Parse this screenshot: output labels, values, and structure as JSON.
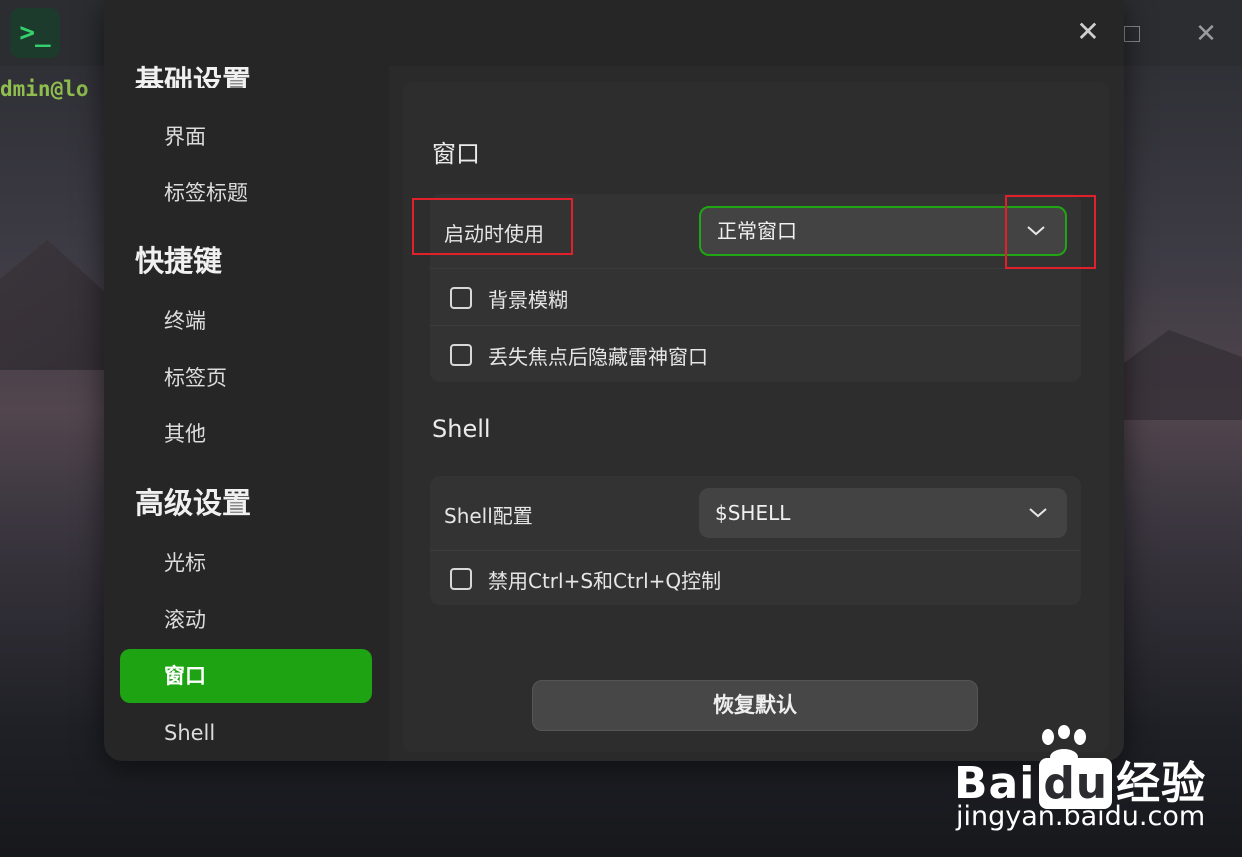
{
  "background": {
    "app_icon": "terminal-prompt-icon",
    "app_icon_glyph": ">_",
    "prompt_text": "dmin@lo",
    "max_icon": "maximize-icon",
    "close_icon": "close-icon"
  },
  "dialog": {
    "close_glyph": "✕",
    "sidebar": {
      "group_basic_partial": "基础设置",
      "items_basic": [
        "界面",
        "标签标题"
      ],
      "group_shortcuts": "快捷键",
      "items_shortcuts": [
        "终端",
        "标签页",
        "其他"
      ],
      "group_advanced": "高级设置",
      "items_advanced": [
        "光标",
        "滚动",
        "窗口",
        "Shell"
      ],
      "active_item": "窗口"
    },
    "window_section": {
      "title": "窗口",
      "startup_label": "启动时使用",
      "startup_value": "正常窗口",
      "blur_label": "背景模糊",
      "hide_label": "丢失焦点后隐藏雷神窗口"
    },
    "shell_section": {
      "title": "Shell",
      "config_label": "Shell配置",
      "config_value": "$SHELL",
      "disable_label": "禁用Ctrl+S和Ctrl+Q控制"
    },
    "restore_button": "恢复默认"
  },
  "watermark": {
    "logo_left": "Bai",
    "logo_mid": "du",
    "logo_right": "经验",
    "url": "jingyan.baidu.com"
  },
  "colors": {
    "accent_green": "#1ea412",
    "highlight_red": "#e0202a"
  }
}
